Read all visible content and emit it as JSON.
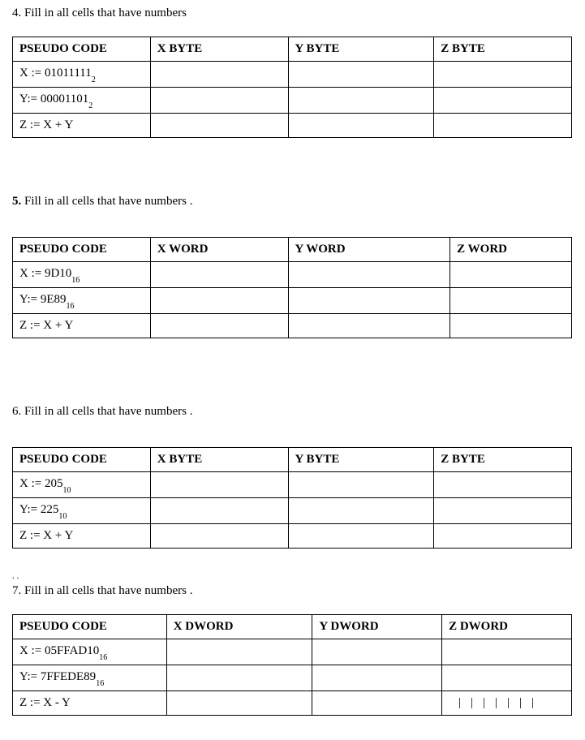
{
  "q4": {
    "number": "4",
    "prompt": ". Fill in all cells that have numbers",
    "headers": [
      "PSEUDO CODE",
      "X  BYTE",
      "Y  BYTE",
      "Z  BYTE"
    ],
    "rows": [
      {
        "code_prefix": "X := 01011111",
        "code_sub": "2"
      },
      {
        "code_prefix": "Y:= 00001101",
        "code_sub": "2"
      },
      {
        "code_prefix": "Z := X + Y",
        "code_sub": ""
      }
    ]
  },
  "q5": {
    "number": "5.",
    "prompt": "  Fill in all cells that have numbers .",
    "headers": [
      "PSEUDO CODE",
      "X  WORD",
      "Y  WORD",
      "Z  WORD"
    ],
    "rows": [
      {
        "code_prefix": "X := 9D10",
        "code_sub": "16"
      },
      {
        "code_prefix": "Y:= 9E89",
        "code_sub": "16"
      },
      {
        "code_prefix": "Z := X + Y",
        "code_sub": ""
      }
    ]
  },
  "q6": {
    "number": "6",
    "prompt": ". Fill in all cells that have numbers .",
    "headers": [
      "PSEUDO CODE",
      "X  BYTE",
      "Y  BYTE",
      "Z  BYTE"
    ],
    "rows": [
      {
        "code_prefix": "X := 205",
        "code_sub": "10"
      },
      {
        "code_prefix": "Y:= 225",
        "code_sub": "10"
      },
      {
        "code_prefix": "Z := X + Y",
        "code_sub": ""
      }
    ]
  },
  "q7": {
    "dots": ". .",
    "number": "7",
    "prompt": ". Fill in all cells that have numbers .",
    "headers": [
      "PSEUDO CODE",
      "X  DWORD",
      "Y  DWORD",
      "Z  DWORD"
    ],
    "rows": [
      {
        "code_prefix": "X := 05FFAD10",
        "code_sub": "16"
      },
      {
        "code_prefix": "Y:= 7FFEDE89",
        "code_sub": "16"
      },
      {
        "code_prefix": "Z := X - Y",
        "code_sub": ""
      }
    ],
    "last_cell_ticks": "|||||||"
  },
  "col_widths_default": [
    "170px",
    "170px",
    "180px",
    "170px"
  ],
  "col_widths_q7": [
    "190px",
    "180px",
    "160px",
    "160px"
  ]
}
